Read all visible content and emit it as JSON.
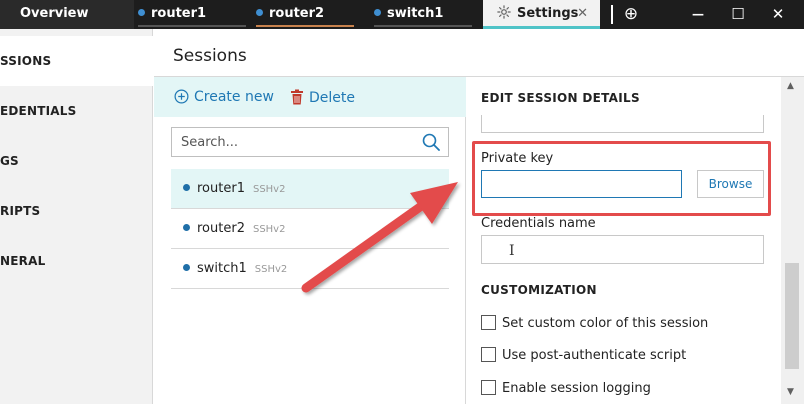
{
  "titlebar": {
    "tabs": [
      {
        "label": "Overview"
      },
      {
        "label": "router1"
      },
      {
        "label": "router2"
      },
      {
        "label": "switch1"
      },
      {
        "label": "Settings",
        "close": "✕"
      }
    ],
    "window_controls": {
      "add": "⊕",
      "minimize": "—",
      "maximize": "☐",
      "close": "✕"
    }
  },
  "sidebar": {
    "items": [
      {
        "label": "SSIONS"
      },
      {
        "label": "EDENTIALS"
      },
      {
        "label": "GS"
      },
      {
        "label": "RIPTS"
      },
      {
        "label": "NERAL"
      }
    ]
  },
  "header": {
    "title": "Sessions"
  },
  "toolbar": {
    "create_label": "Create new",
    "delete_label": "Delete"
  },
  "search": {
    "placeholder": "Search..."
  },
  "sessions": [
    {
      "name": "router1",
      "protocol": "SSHv2"
    },
    {
      "name": "router2",
      "protocol": "SSHv2"
    },
    {
      "name": "switch1",
      "protocol": "SSHv2"
    }
  ],
  "details": {
    "title": "EDIT SESSION DETAILS",
    "private_key_label": "Private key",
    "browse_label": "Browse",
    "credentials_label": "Credentials name",
    "customization_title": "CUSTOMIZATION",
    "options": [
      {
        "label": "Set custom color of this session",
        "checked": false
      },
      {
        "label": "Use post-authenticate script",
        "checked": false
      },
      {
        "label": "Enable session logging",
        "checked": false
      }
    ]
  },
  "colors": {
    "accent": "#1f78b4",
    "highlight": "#e34b4b",
    "selected_row": "#e3f6f6"
  }
}
